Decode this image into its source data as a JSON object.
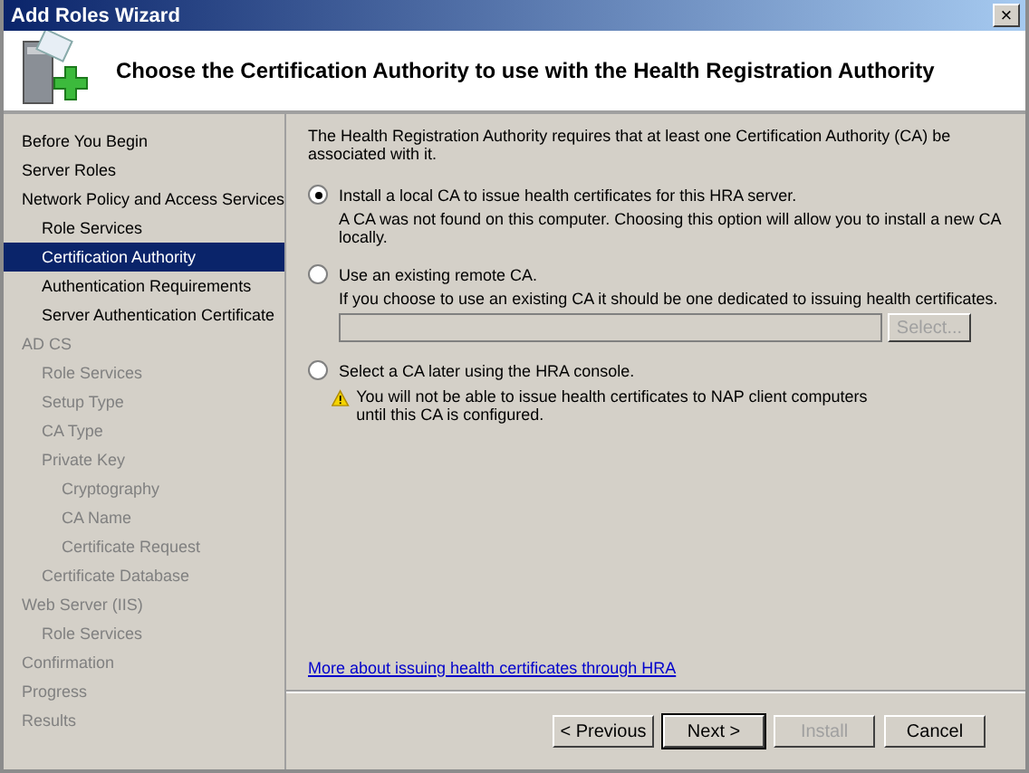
{
  "window": {
    "title": "Add Roles Wizard",
    "close_label": "×"
  },
  "header": {
    "title": "Choose the Certification Authority to use with the Health Registration Authority"
  },
  "sidebar": {
    "items": [
      {
        "label": "Before You Begin",
        "selected": false,
        "disabled": false
      },
      {
        "label": "Server Roles",
        "selected": false,
        "disabled": false
      },
      {
        "label": "Network Policy and Access Services",
        "selected": false,
        "disabled": false,
        "children": [
          {
            "label": "Role Services",
            "selected": false,
            "disabled": false
          },
          {
            "label": "Certification Authority",
            "selected": true,
            "disabled": false
          },
          {
            "label": "Authentication Requirements",
            "selected": false,
            "disabled": false
          },
          {
            "label": "Server Authentication Certificate",
            "selected": false,
            "disabled": false
          }
        ]
      },
      {
        "label": "AD CS",
        "selected": false,
        "disabled": true,
        "children": [
          {
            "label": "Role Services",
            "selected": false,
            "disabled": true
          },
          {
            "label": "Setup Type",
            "selected": false,
            "disabled": true
          },
          {
            "label": "CA Type",
            "selected": false,
            "disabled": true
          },
          {
            "label": "Private Key",
            "selected": false,
            "disabled": true,
            "children": [
              {
                "label": "Cryptography",
                "selected": false,
                "disabled": true
              },
              {
                "label": "CA Name",
                "selected": false,
                "disabled": true
              },
              {
                "label": "Certificate Request",
                "selected": false,
                "disabled": true
              }
            ]
          },
          {
            "label": "Certificate Database",
            "selected": false,
            "disabled": true
          }
        ]
      },
      {
        "label": "Web Server (IIS)",
        "selected": false,
        "disabled": true,
        "children": [
          {
            "label": "Role Services",
            "selected": false,
            "disabled": true
          }
        ]
      },
      {
        "label": "Confirmation",
        "selected": false,
        "disabled": true
      },
      {
        "label": "Progress",
        "selected": false,
        "disabled": true
      },
      {
        "label": "Results",
        "selected": false,
        "disabled": true
      }
    ]
  },
  "content": {
    "intro": "The Health Registration Authority requires that at least one Certification Authority (CA) be associated with it.",
    "options": [
      {
        "label": "Install a local CA to issue health certificates for this HRA server.",
        "selected": true,
        "note": "A CA was not found on this computer. Choosing this option will allow you to install a new CA locally."
      },
      {
        "label": "Use an existing remote CA.",
        "selected": false,
        "note": "If you choose to use an existing CA it should be one dedicated to issuing health certificates.",
        "field": {
          "disabled": true,
          "button": {
            "label": "Select...",
            "disabled": true
          }
        }
      },
      {
        "label": "Select a CA later using the HRA console.",
        "selected": false,
        "warning": "You will not be able to issue health certificates to NAP client computers until this CA is configured."
      }
    ],
    "link": "More about issuing health certificates through HRA"
  },
  "buttons": [
    {
      "label": "< Previous",
      "disabled": false,
      "default": false
    },
    {
      "label": "Next >",
      "disabled": false,
      "default": true
    },
    {
      "label": "Install",
      "disabled": true,
      "default": false
    },
    {
      "label": "Cancel",
      "disabled": false,
      "default": false
    }
  ]
}
